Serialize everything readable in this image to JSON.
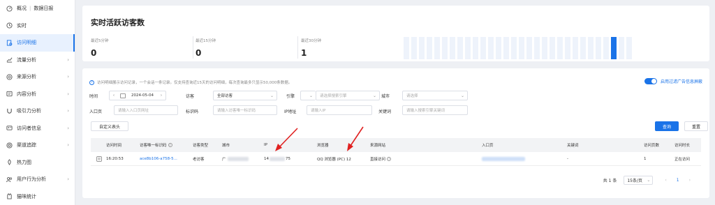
{
  "sidebar": {
    "items": [
      {
        "label": "概况",
        "extra": "数据日报",
        "icon": "gauge-icon",
        "chevron": false,
        "active": false
      },
      {
        "label": "实时",
        "icon": "clock-icon",
        "chevron": false,
        "active": false
      },
      {
        "label": "访问明细",
        "icon": "document-icon",
        "chevron": false,
        "active": true
      },
      {
        "label": "流量分析",
        "icon": "trend-icon",
        "chevron": true,
        "active": false
      },
      {
        "label": "来源分析",
        "icon": "source-icon",
        "chevron": true,
        "active": false
      },
      {
        "label": "内容分析",
        "icon": "content-icon",
        "chevron": true,
        "active": false
      },
      {
        "label": "吸引力分析",
        "icon": "magnet-icon",
        "chevron": true,
        "active": false
      },
      {
        "label": "访问者信息",
        "icon": "visitor-icon",
        "chevron": true,
        "active": false
      },
      {
        "label": "渠道追踪",
        "icon": "target-icon",
        "chevron": true,
        "active": false
      },
      {
        "label": "热力图",
        "icon": "heatmap-icon",
        "chevron": false,
        "active": false
      },
      {
        "label": "用户行为分析",
        "icon": "users-icon",
        "chevron": true,
        "active": false
      },
      {
        "label": "猫咪统计",
        "icon": "cat-icon",
        "chevron": false,
        "active": false
      }
    ]
  },
  "realtime": {
    "title": "实时活跃访客数",
    "stats": [
      {
        "label": "最近5分钟",
        "value": "0"
      },
      {
        "label": "最近15分钟",
        "value": "0"
      },
      {
        "label": "最近30分钟",
        "value": "1"
      }
    ],
    "bars": 30,
    "highlight_bar_index": 27,
    "accent": "#1a73e8"
  },
  "detail": {
    "tip": "访问明细展示访问记录，一个会话一条记录。仅支持查询近15天的访问明细，每次查询最多只显示50,000条数据。",
    "toggle_label": "启用过滤广告信息屏蔽",
    "filters": {
      "time_label": "时间",
      "date_value": "2024-05-04",
      "visitor_label": "访客",
      "visitor_value": "全部访客",
      "engine_label": "引擎",
      "engine_placeholder": "请选择搜索引擎",
      "city_label": "城市",
      "city_placeholder": "请选择",
      "entry_label": "入口页",
      "entry_placeholder": "请输入入口页网址",
      "visitor_id_label": "标识码",
      "visitor_id_placeholder": "请输入访客唯一标识码",
      "ip_label": "IP地址",
      "ip_placeholder": "请输入IP",
      "keyword_label": "关键词",
      "keyword_placeholder": "请输入搜索引擎关键词"
    },
    "custom_columns_button": "自定义表头",
    "query_button": "查询",
    "reset_button": "重置",
    "table": {
      "headers": [
        "访问时间",
        "访客唯一标识码",
        "访客类型",
        "城市",
        "IP",
        "浏览器",
        "来源网站",
        "入口页",
        "关键词",
        "访问页数",
        "访问时长"
      ],
      "row": {
        "time": "16:20:53",
        "visitor_id": "ace8b106-a758-5...",
        "visitor_type": "老访客",
        "city": "广",
        "ip_start": "14",
        "ip_end": "75",
        "browser": "QQ 浏览器 (PC) 12",
        "source": "直接访问",
        "keyword": "-",
        "pages": "1",
        "duration": "正在访问"
      }
    },
    "pagination": {
      "total": "共 1 条",
      "page_size": "15条/页",
      "current_page": "1"
    }
  }
}
